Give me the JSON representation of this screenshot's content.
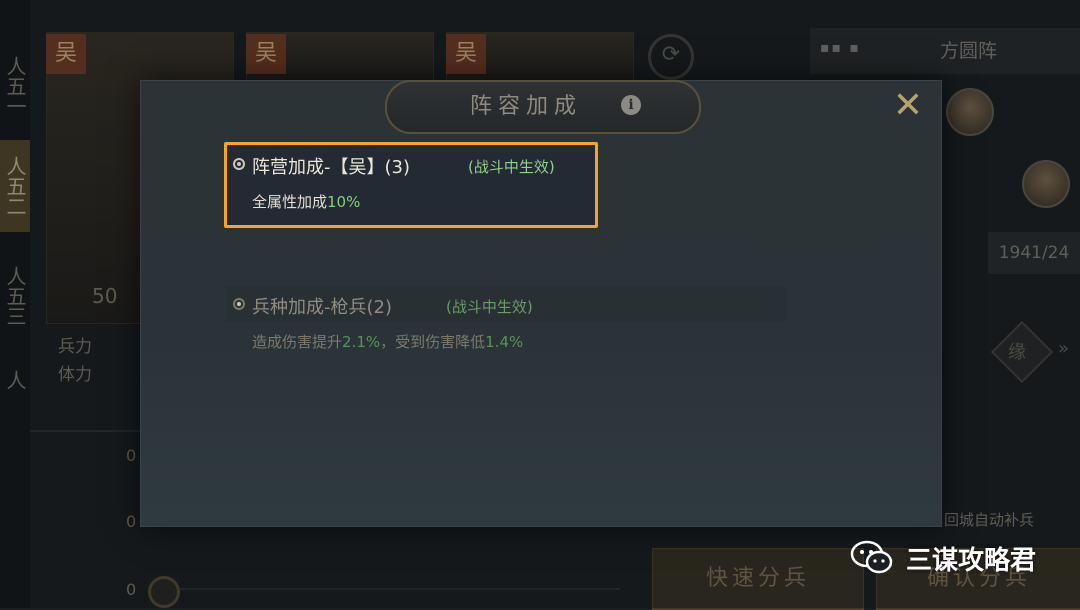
{
  "background": {
    "rail_tabs": [
      "人五一",
      "人五二",
      "人五三",
      "人"
    ],
    "faction_label": "吴",
    "hero_troops": "50",
    "stat_labels": [
      "兵力",
      "体力"
    ],
    "formation_name": "方圆阵",
    "formation_icon": "formation-dots-icon",
    "troop_value": "1941/24",
    "bond_label": "缘",
    "row_values": [
      "0",
      "0",
      "0"
    ],
    "auto_refill_label": "回城自动补兵",
    "quick_split_label": "快速分兵",
    "confirm_split_label": "确认分兵"
  },
  "modal": {
    "title": "阵容加成",
    "info_icon": "i",
    "close_icon": "close-x-icon",
    "bonuses": [
      {
        "title": "阵营加成-【吴】(3)",
        "note": "(战斗中生效)",
        "desc_prefix": "全属性加成",
        "desc_value": "10%",
        "active": true
      },
      {
        "title": "兵种加成-枪兵(2)",
        "note": "(战斗中生效)",
        "desc_prefix": "造成伤害提升",
        "desc_value": "2.1%",
        "desc_mid": "，受到伤害降低",
        "desc_value2": "1.4%",
        "active": false
      }
    ]
  },
  "watermark": {
    "text": "三谋攻略君",
    "icon": "wechat-icon"
  },
  "colors": {
    "highlight_border": "#f5a623",
    "green_value": "#7fd27a",
    "note_green": "#8fd08a"
  }
}
